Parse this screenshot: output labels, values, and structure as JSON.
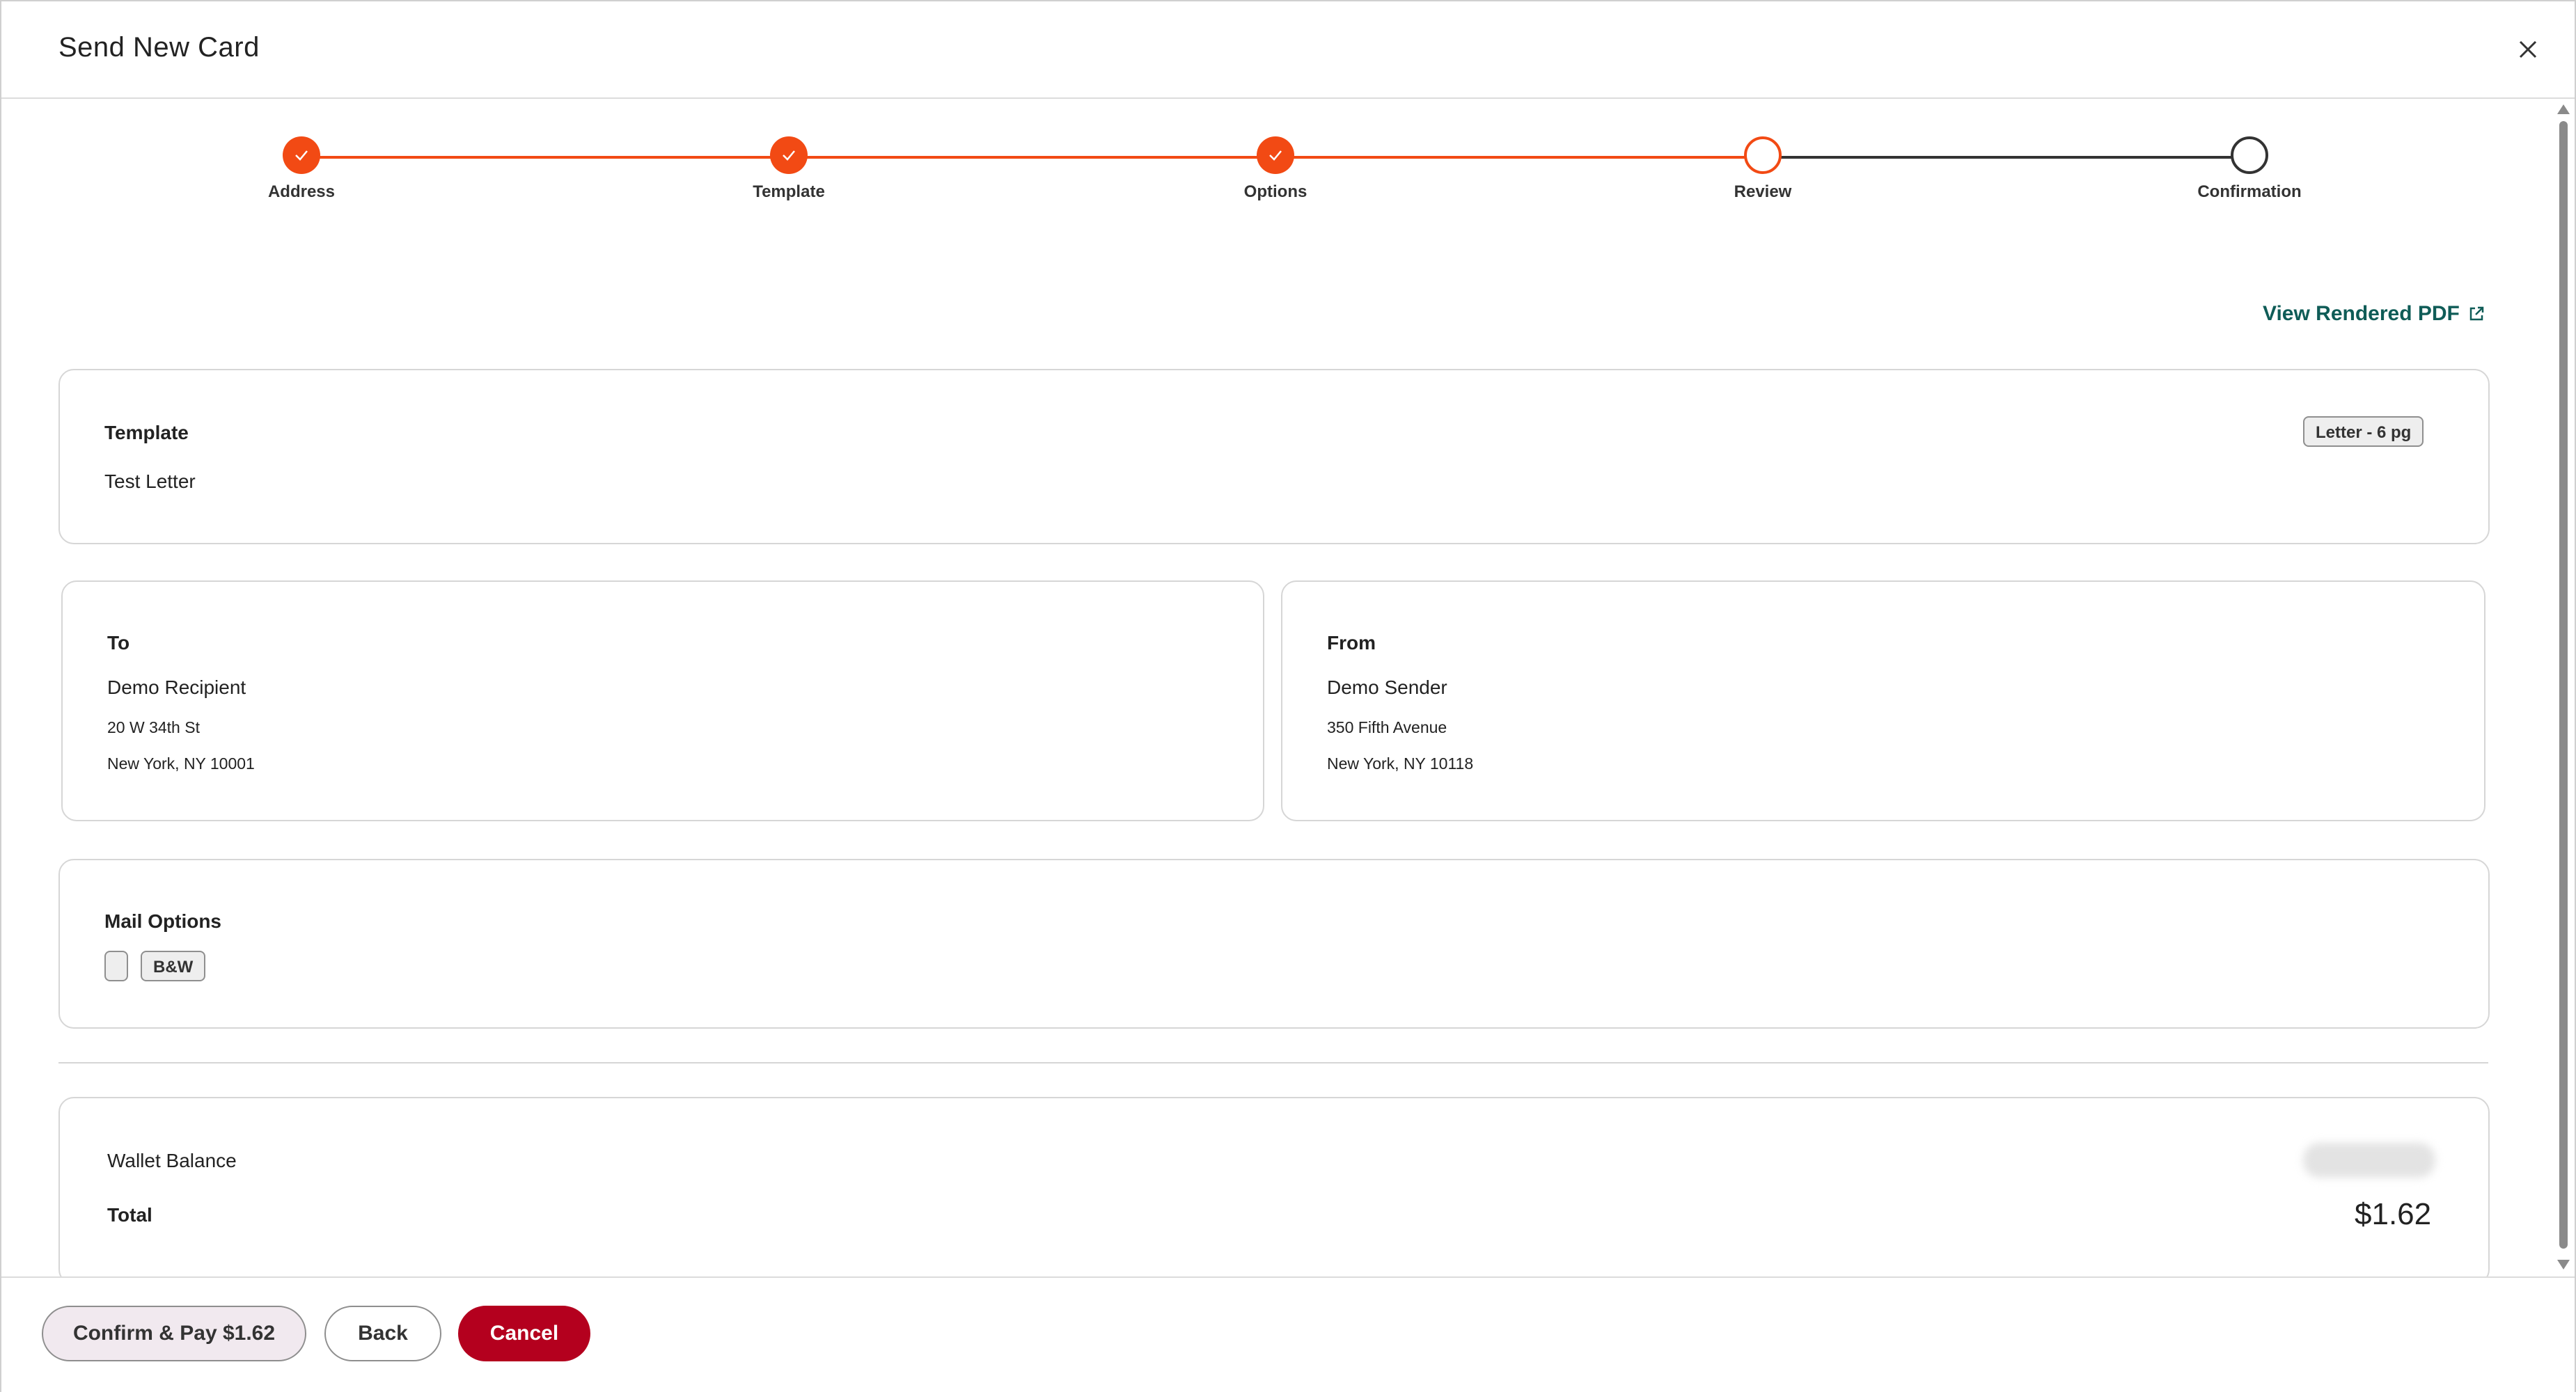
{
  "header": {
    "title": "Send New Card"
  },
  "stepper": {
    "steps": [
      {
        "label": "Address",
        "state": "done"
      },
      {
        "label": "Template",
        "state": "done"
      },
      {
        "label": "Options",
        "state": "done"
      },
      {
        "label": "Review",
        "state": "current"
      },
      {
        "label": "Confirmation",
        "state": "todo"
      }
    ]
  },
  "view_pdf_label": "View Rendered PDF",
  "template_card": {
    "heading": "Template",
    "name": "Test Letter",
    "badge": "Letter - 6 pg"
  },
  "to_card": {
    "heading": "To",
    "name": "Demo Recipient",
    "line1": "20 W 34th St",
    "line2": "New York, NY 10001"
  },
  "from_card": {
    "heading": "From",
    "name": "Demo Sender",
    "line1": "350 Fifth Avenue",
    "line2": "New York, NY 10118"
  },
  "mail_options": {
    "heading": "Mail Options",
    "badge": "B&W"
  },
  "payment": {
    "wallet_label": "Wallet Balance",
    "total_label": "Total",
    "total_value": "$1.62"
  },
  "footer": {
    "confirm_label": "Confirm & Pay $1.62",
    "back_label": "Back",
    "cancel_label": "Cancel"
  },
  "colors": {
    "accent": "#f24a14",
    "link": "#0f5c57",
    "cancel": "#b4001e"
  }
}
